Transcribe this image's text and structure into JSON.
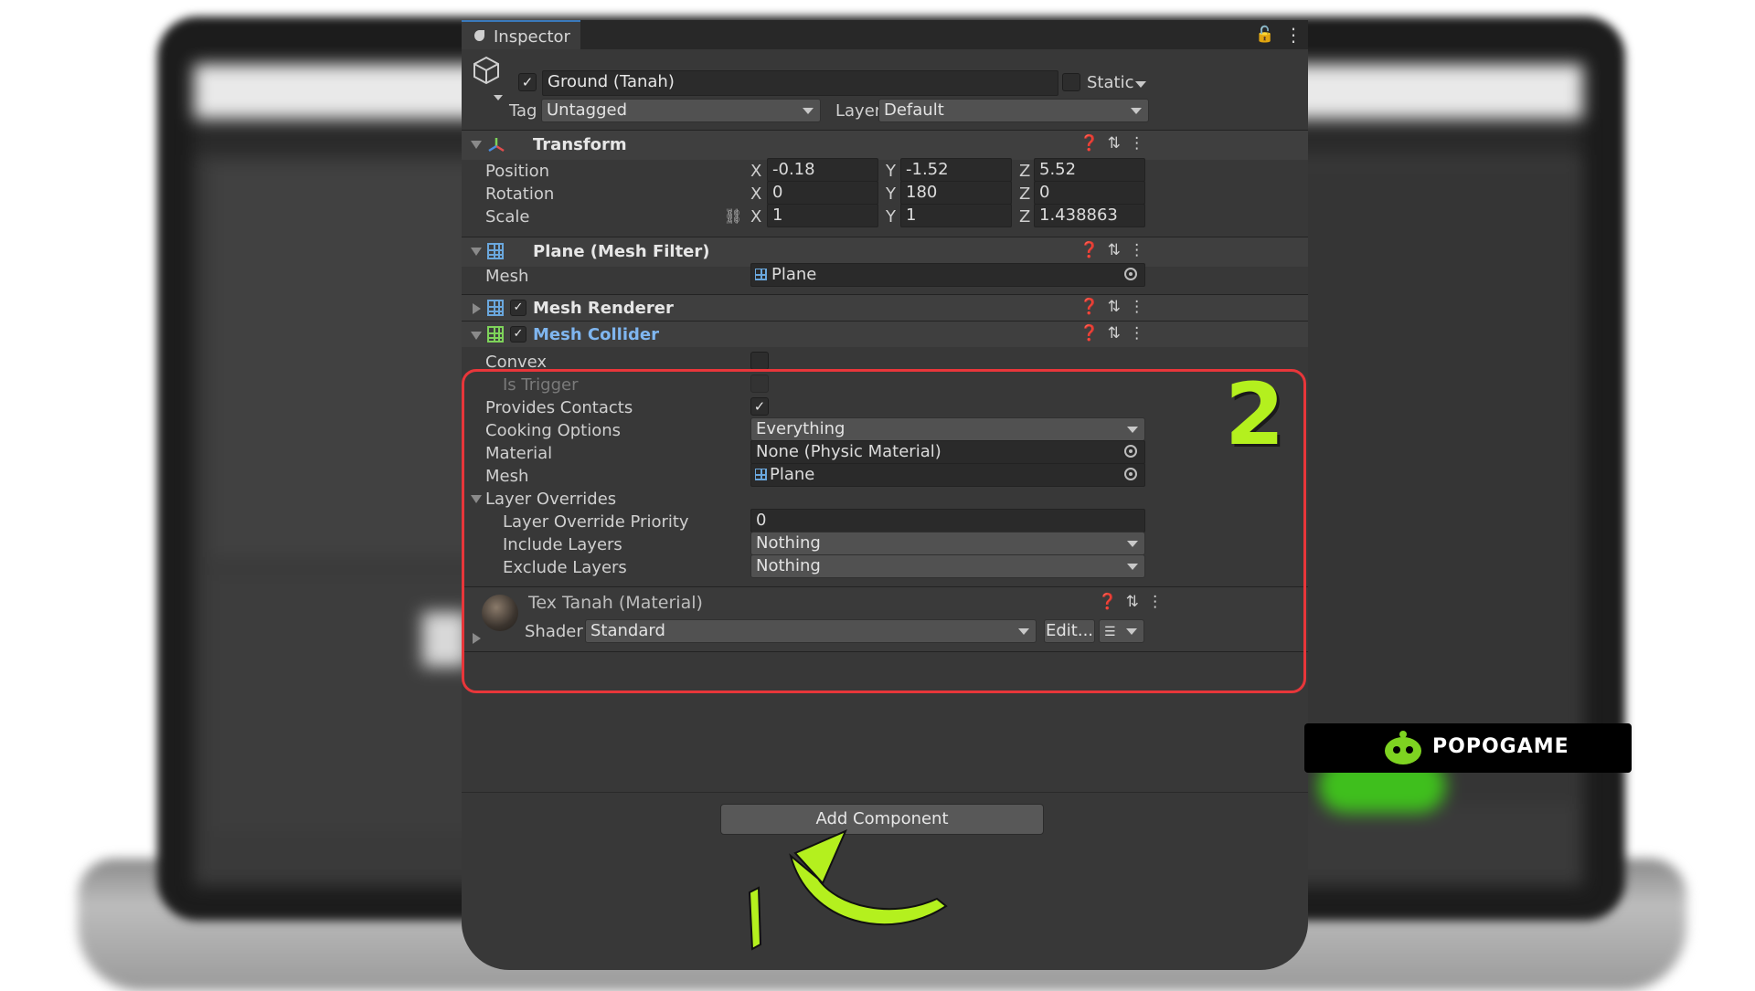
{
  "inspector": {
    "tab_label": "Inspector",
    "object_name": "Ground (Tanah)",
    "static_label": "Static",
    "tag_label": "Tag",
    "tag_value": "Untagged",
    "layer_label": "Layer",
    "layer_value": "Default"
  },
  "transform": {
    "title": "Transform",
    "position_label": "Position",
    "rotation_label": "Rotation",
    "scale_label": "Scale",
    "axis_x": "X",
    "axis_y": "Y",
    "axis_z": "Z",
    "position": {
      "x": "-0.18",
      "y": "-1.52",
      "z": "5.52"
    },
    "rotation": {
      "x": "0",
      "y": "180",
      "z": "0"
    },
    "scale": {
      "x": "1",
      "y": "1",
      "z": "1.438863"
    }
  },
  "mesh_filter": {
    "title": "Plane (Mesh Filter)",
    "mesh_label": "Mesh",
    "mesh_value": "Plane"
  },
  "mesh_renderer": {
    "title": "Mesh Renderer"
  },
  "mesh_collider": {
    "title": "Mesh Collider",
    "convex_label": "Convex",
    "is_trigger_label": "Is Trigger",
    "provides_contacts_label": "Provides Contacts",
    "cooking_options_label": "Cooking Options",
    "cooking_options_value": "Everything",
    "material_label": "Material",
    "material_value": "None (Physic Material)",
    "mesh_label": "Mesh",
    "mesh_value": "Plane",
    "layer_overrides_label": "Layer Overrides",
    "layer_override_priority_label": "Layer Override Priority",
    "layer_override_priority_value": "0",
    "include_layers_label": "Include Layers",
    "include_layers_value": "Nothing",
    "exclude_layers_label": "Exclude Layers",
    "exclude_layers_value": "Nothing"
  },
  "material": {
    "title": "Tex Tanah (Material)",
    "shader_label": "Shader",
    "shader_value": "Standard",
    "edit_label": "Edit..."
  },
  "add_component_label": "Add Component",
  "annotations": {
    "step_1": "1",
    "step_2": "2",
    "highlight_color": "#e8363a",
    "accent_color": "#b4f01e"
  },
  "watermark": {
    "text": "POPOGAME"
  }
}
